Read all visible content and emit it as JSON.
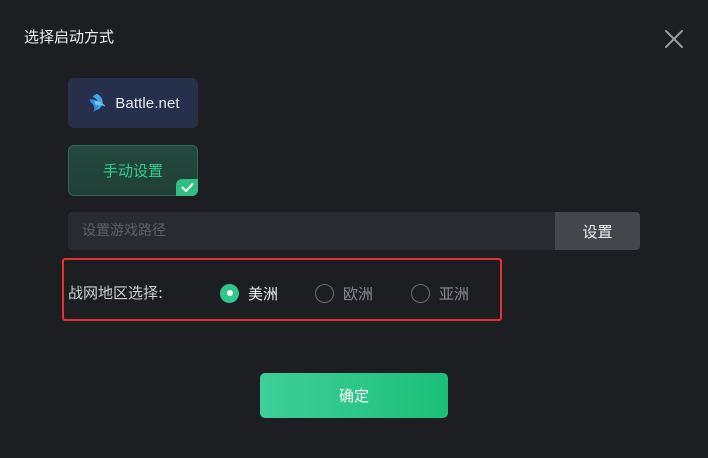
{
  "dialog": {
    "title": "选择启动方式"
  },
  "launch_options": {
    "battlenet_label": "Battle.net",
    "manual_label": "手动设置",
    "selected": "manual"
  },
  "path": {
    "placeholder": "设置游戏路径",
    "value": "",
    "button_label": "设置"
  },
  "region": {
    "label": "战网地区选择:",
    "options": [
      {
        "label": "美洲",
        "selected": true
      },
      {
        "label": "欧洲",
        "selected": false
      },
      {
        "label": "亚洲",
        "selected": false
      }
    ],
    "highlight_color": "#e5322e"
  },
  "actions": {
    "confirm_label": "确定"
  },
  "colors": {
    "accent": "#2fc78c",
    "background": "#1d1e22"
  },
  "icons": {
    "close": "close-icon",
    "battlenet": "battlenet-logo-icon",
    "check": "checkmark-icon"
  }
}
